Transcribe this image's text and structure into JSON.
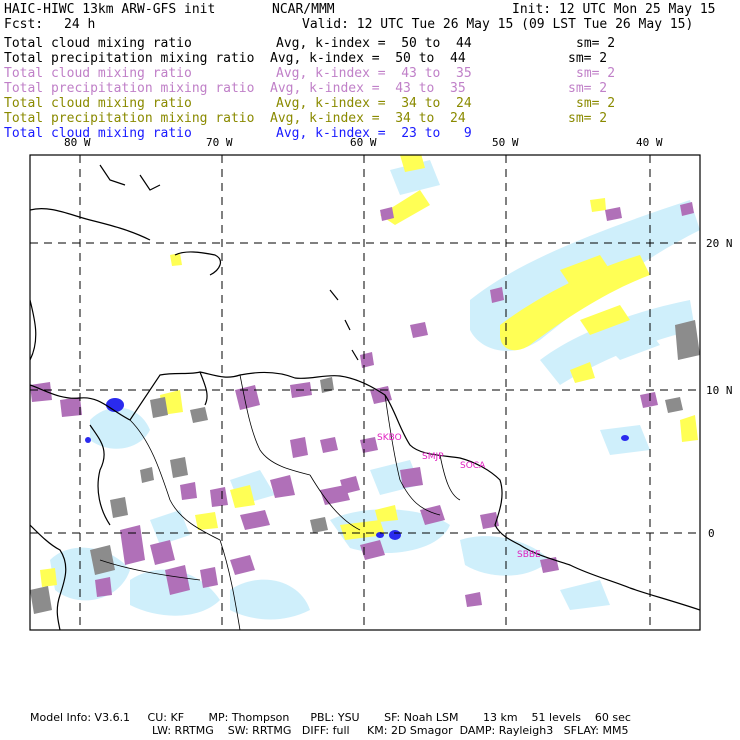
{
  "header": {
    "title": "HAIC-HIWC 13km ARW-GFS init",
    "org": "NCAR/MMM",
    "init": "Init: 12 UTC Mon 25 May 15",
    "fcst_label": "Fcst:",
    "fcst_value": "24 h",
    "valid": "Valid: 12 UTC Tue 26 May 15 (09 LST Tue 26 May 15)"
  },
  "legend": [
    {
      "field": "Total cloud mixing ratio",
      "avg": "Avg, k-index =  50 to  44",
      "sm": "sm= 2",
      "color": "#000000"
    },
    {
      "field": "Total precipitation mixing ratio",
      "avg": "Avg, k-index =  50 to  44",
      "sm": "sm= 2",
      "color": "#000000"
    },
    {
      "field": "Total cloud mixing ratio",
      "avg": "Avg, k-index =  43 to  35",
      "sm": "sm= 2",
      "color": "#c080c8"
    },
    {
      "field": "Total precipitation mixing ratio",
      "avg": "Avg, k-index =  43 to  35",
      "sm": "sm= 2",
      "color": "#c080c8"
    },
    {
      "field": "Total cloud mixing ratio",
      "avg": "Avg, k-index =  34 to  24",
      "sm": "sm= 2",
      "color": "#8a8a00"
    },
    {
      "field": "Total precipitation mixing ratio",
      "avg": "Avg, k-index =  34 to  24",
      "sm": "sm= 2",
      "color": "#8a8a00"
    },
    {
      "field": "Total cloud mixing ratio",
      "avg": "Avg, k-index =  23 to   9",
      "sm": "",
      "color": "#1a1aff"
    }
  ],
  "map": {
    "lon_labels": [
      "80 W",
      "70 W",
      "60 W",
      "50 W",
      "40 W"
    ],
    "lat_labels": [
      "20 N",
      "10 N",
      "0"
    ],
    "stations": [
      "SKBO",
      "SMJP",
      "SOCA",
      "SBBE"
    ],
    "station_color": "#e020c0",
    "colors": {
      "cyan": "#cfeffb",
      "yellow": "#ffff55",
      "purple": "#b070b8",
      "gray": "#8c8c8c",
      "blue": "#2a2aee"
    }
  },
  "footer": {
    "line1": "Model Info: V3.6.1     CU: KF       MP: Thompson      PBL: YSU       SF: Noah LSM       13 km    51 levels    60 sec",
    "line2": "LW: RRTMG    SW: RRTMG   DIFF: full     KM: 2D Smagor  DAMP: Rayleigh3   SFLAY: MM5"
  }
}
